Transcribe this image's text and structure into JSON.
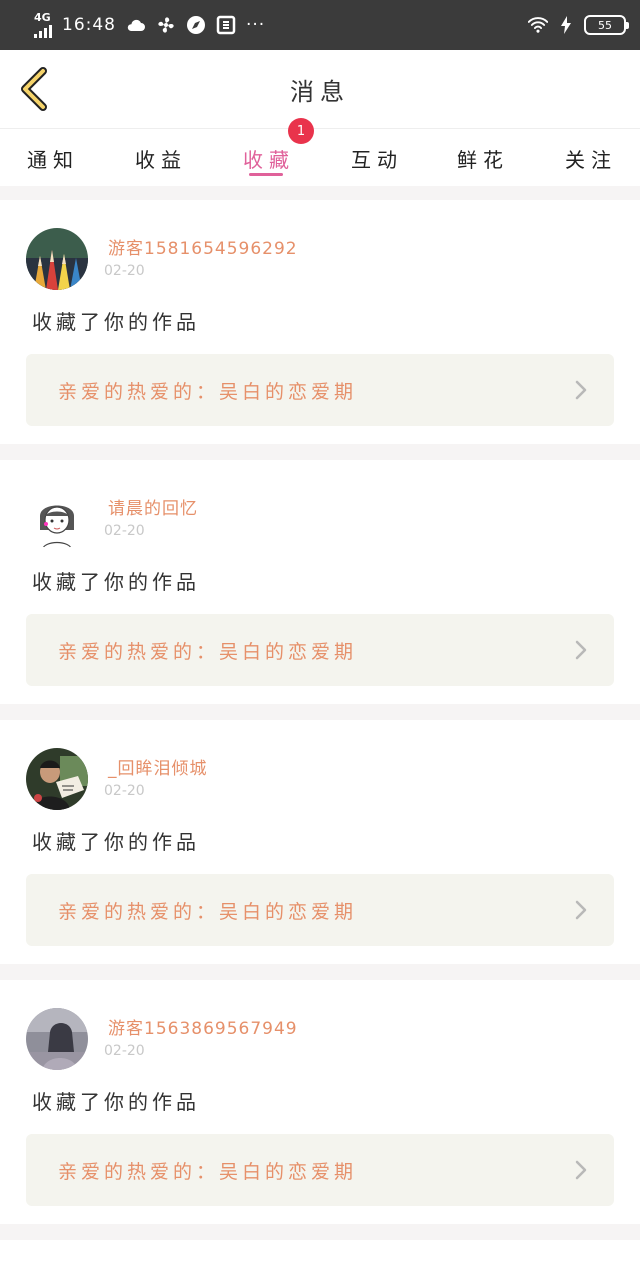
{
  "status_bar": {
    "network": "4G",
    "time": "16:48",
    "battery": "55",
    "more": "···"
  },
  "header": {
    "title": "消息"
  },
  "tabs": [
    {
      "label": "通知"
    },
    {
      "label": "收益"
    },
    {
      "label": "收藏",
      "active": true,
      "badge": "1"
    },
    {
      "label": "互动"
    },
    {
      "label": "鲜花"
    },
    {
      "label": "关注"
    }
  ],
  "messages": [
    {
      "username": "游客1581654596292",
      "date": "02-20",
      "action": "收藏了你的作品",
      "work_title": "亲爱的热爱的：吴白的恋爱期",
      "avatar": "pencils"
    },
    {
      "username": "请晨的回忆",
      "date": "02-20",
      "action": "收藏了你的作品",
      "work_title": "亲爱的热爱的：吴白的恋爱期",
      "avatar": "girl-drawing"
    },
    {
      "username": "_回眸泪倾城",
      "date": "02-20",
      "action": "收藏了你的作品",
      "work_title": "亲爱的热爱的：吴白的恋爱期",
      "avatar": "man-photo"
    },
    {
      "username": "游客1563869567949",
      "date": "02-20",
      "action": "收藏了你的作品",
      "work_title": "亲爱的热爱的：吴白的恋爱期",
      "avatar": "blurred-photo"
    }
  ],
  "colors": {
    "accent": "#e0619a",
    "badge": "#e9334c",
    "username": "#e6906a",
    "link_bg": "#f4f4ee"
  }
}
